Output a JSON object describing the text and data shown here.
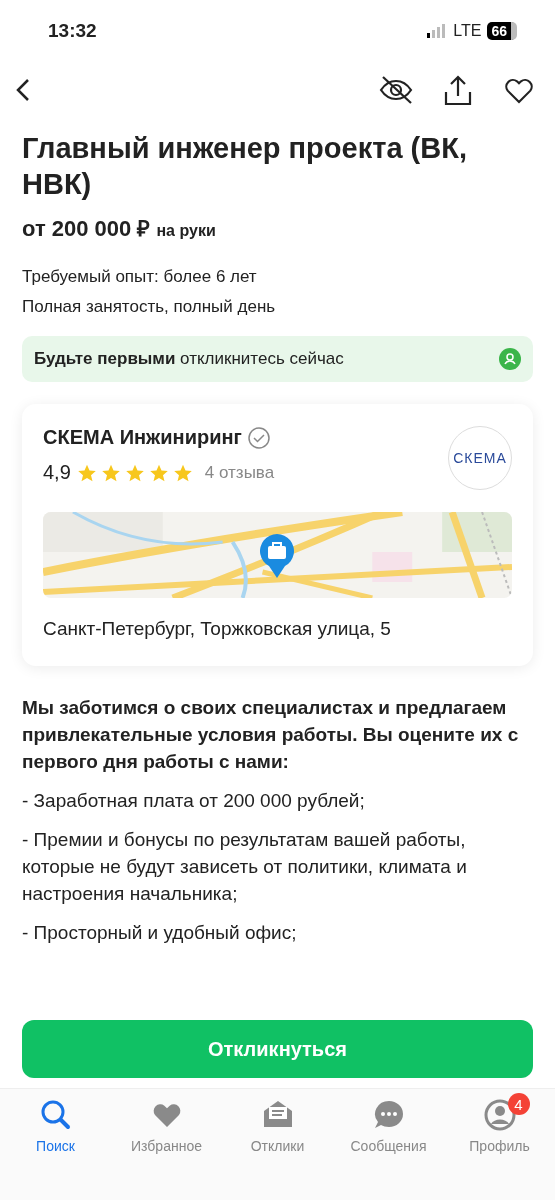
{
  "status_bar": {
    "time": "13:32",
    "network": "LTE",
    "battery": "66"
  },
  "title": "Главный инженер проекта (ВК, НВК)",
  "salary": {
    "amount": "от 200 000 ₽",
    "note": "на руки"
  },
  "details": [
    "Требуемый опыт: более 6 лет",
    "Полная занятость, полный день"
  ],
  "banner": {
    "text": "**Будьте первыми** откликнитесь сейчас"
  },
  "company": {
    "name": "СКЕМА Инжиниринг",
    "verified": true,
    "logo": "СКЕМА",
    "rating": "4,9",
    "stars": 5,
    "reviews": "4 отзыва",
    "address": "Санкт-Петербург, Торжковская улица, 5"
  },
  "description": {
    "intro": "Мы заботимся о своих специалистах и предлагаем привлекательные условия работы. Вы оцените их с первого дня работы с нами:",
    "items": [
      "- Заработная плата от 200 000 рублей;",
      "- Премии и бонусы по результатам вашей работы, которые не будут зависеть от политики, климата и настроения начальника;",
      "- Просторный и удобный офис;"
    ]
  },
  "apply_button": "Откликнуться",
  "tab_bar": [
    {
      "label": "Поиск",
      "kind": "search",
      "selected": true
    },
    {
      "label": "Избранное",
      "kind": "heart",
      "selected": false
    },
    {
      "label": "Отклики",
      "kind": "mail",
      "selected": false
    },
    {
      "label": "Сообщения",
      "kind": "chat",
      "selected": false
    },
    {
      "label": "Профиль",
      "kind": "profile",
      "selected": false,
      "badge": "4"
    }
  ]
}
